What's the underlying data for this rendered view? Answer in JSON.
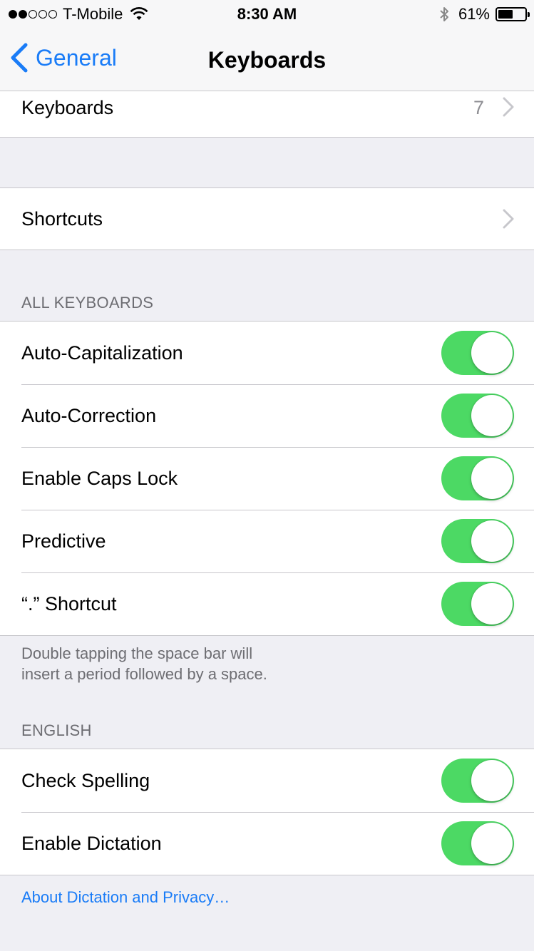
{
  "status_bar": {
    "carrier": "T-Mobile",
    "time": "8:30 AM",
    "battery": "61%",
    "battery_level": 0.61,
    "signal_bars_filled": 2,
    "signal_bars_total": 5
  },
  "nav": {
    "back_label": "General",
    "title": "Keyboards"
  },
  "keyboards_row": {
    "label": "Keyboards",
    "value": "7"
  },
  "shortcuts_row": {
    "label": "Shortcuts"
  },
  "all_keyboards": {
    "header": "ALL KEYBOARDS",
    "items": [
      {
        "label": "Auto-Capitalization",
        "on": true
      },
      {
        "label": "Auto-Correction",
        "on": true
      },
      {
        "label": "Enable Caps Lock",
        "on": true
      },
      {
        "label": "Predictive",
        "on": true
      },
      {
        "label": "“.” Shortcut",
        "on": true
      }
    ],
    "footer_line1": "Double tapping the space bar will",
    "footer_line2": "insert a period followed by a space."
  },
  "english": {
    "header": "ENGLISH",
    "items": [
      {
        "label": "Check Spelling",
        "on": true
      },
      {
        "label": "Enable Dictation",
        "on": true
      }
    ],
    "link": "About Dictation and Privacy…"
  },
  "colors": {
    "accent": "#1a7cf7",
    "toggle_on": "#4cd964",
    "background": "#efeff4"
  }
}
